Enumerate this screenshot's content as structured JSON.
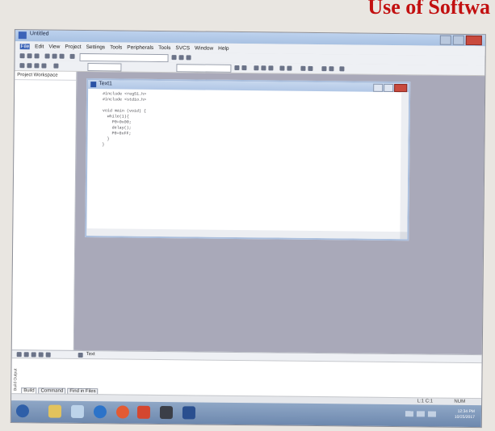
{
  "slide": {
    "title": "Use of Softwa"
  },
  "window": {
    "title": "Untitled"
  },
  "menu": [
    "File",
    "Edit",
    "View",
    "Project",
    "Settings",
    "Tools",
    "Peripherals",
    "Tools",
    "SVCS",
    "Window",
    "Help"
  ],
  "left_panel": {
    "label": "Project Workspace"
  },
  "editor": {
    "title": "Text1",
    "lines": [
      "#include <reg51.h>",
      "#include <stdio.h>",
      "",
      "void main (void) {",
      "  while(1){",
      "    P0=0x00;",
      "    delay();",
      "    P0=0xFF;",
      "  }",
      "}"
    ]
  },
  "bottom": {
    "tab_label": "Text"
  },
  "output_tabs": [
    "Build",
    "Command",
    "Find in Files"
  ],
  "output_label": "Build Output",
  "status": {
    "position": "L:1 C:1",
    "mode": "NUM"
  },
  "tray": {
    "time": "12:34 PM",
    "date": "10/25/2017"
  },
  "colors": {
    "title_red": "#c21010",
    "taskbar": "#7d96b9",
    "mdi_background": "#a9a9b9"
  }
}
